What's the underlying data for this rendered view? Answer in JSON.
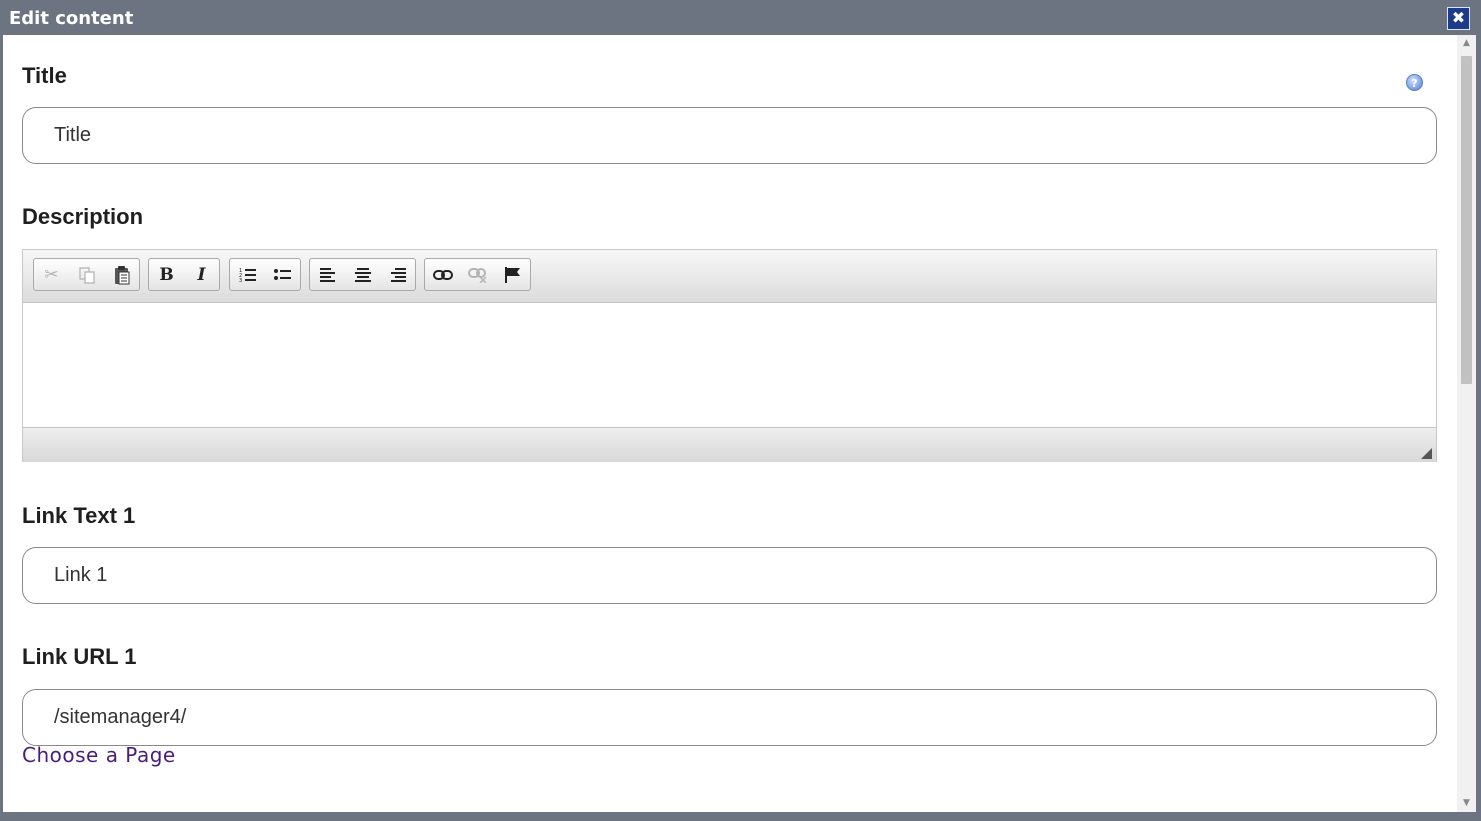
{
  "dialog": {
    "title": "Edit content",
    "close_icon": "close-icon"
  },
  "fields": {
    "title": {
      "label": "Title",
      "value": "Title"
    },
    "description": {
      "label": "Description"
    },
    "link_text_1": {
      "label": "Link Text 1",
      "value": "Link 1"
    },
    "link_url_1": {
      "label": "Link URL 1",
      "value": "/sitemanager4/"
    }
  },
  "help_icon": "help-icon",
  "toolbar": {
    "groups": [
      [
        "cut-icon",
        "copy-icon",
        "paste-icon"
      ],
      [
        "bold-icon",
        "italic-icon"
      ],
      [
        "numbered-list-icon",
        "bulleted-list-icon"
      ],
      [
        "align-left-icon",
        "align-center-icon",
        "align-right-icon"
      ],
      [
        "link-icon",
        "unlink-icon",
        "anchor-flag-icon"
      ]
    ],
    "bold_label": "B",
    "italic_label": "I"
  },
  "choose_page_link": "Choose a Page",
  "colors": {
    "titlebar": "#6c7482",
    "close_button": "#1e3a8a",
    "link": "#4b1d7a"
  }
}
